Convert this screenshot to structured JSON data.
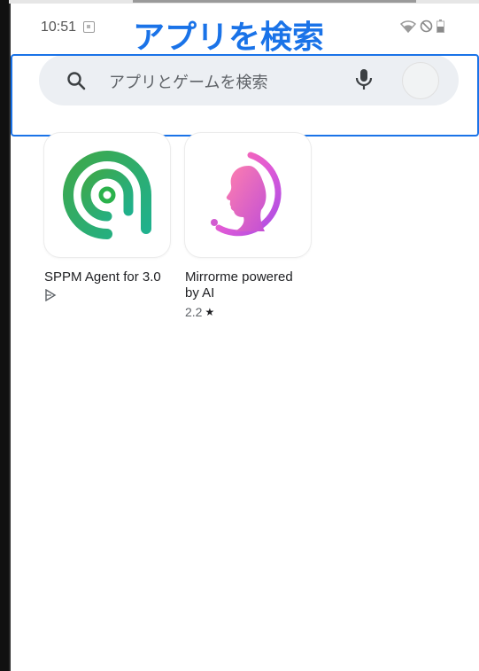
{
  "status_bar": {
    "time": "10:51",
    "icons": [
      "wifi-icon",
      "do-not-disturb-icon",
      "battery-icon"
    ]
  },
  "annotation": {
    "text": "アプリを検索",
    "color": "#1a73e8"
  },
  "search": {
    "placeholder": "アプリとゲームを検索",
    "icon": "search-icon",
    "mic_icon": "mic-icon"
  },
  "apps": [
    {
      "title": "SPPM Agent for 3.0",
      "meta_icon": "play-protect-icon",
      "rating": "",
      "icon": "sppm-app-icon",
      "brand_color": "#2bb24c"
    },
    {
      "title": "Mirrorme powered by AI",
      "rating": "2.2",
      "rating_icon": "star-icon",
      "icon": "mirrorme-app-icon",
      "brand_color": "#c94bd8"
    }
  ]
}
